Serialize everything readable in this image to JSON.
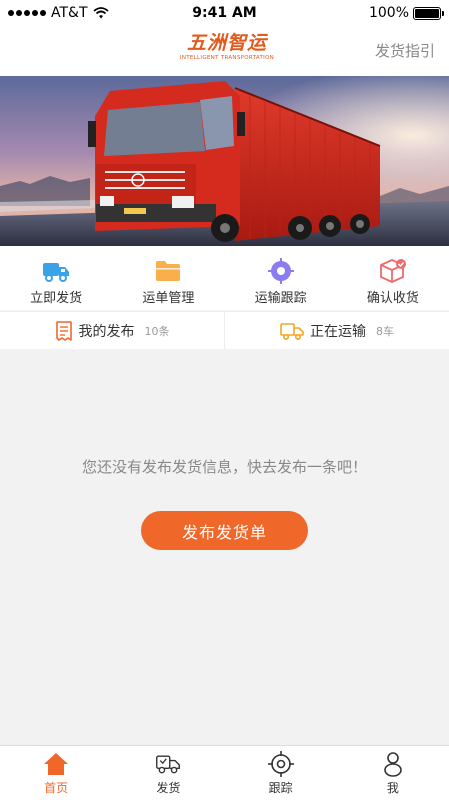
{
  "status_bar": {
    "carrier": "AT&T",
    "time": "9:41 AM",
    "battery": "100%"
  },
  "header": {
    "logo_text": "五洲智运",
    "logo_subtext": "INTELLIGENT TRANSPORTATION",
    "right_link": "发货指引"
  },
  "quick_actions": [
    {
      "label": "立即发货",
      "icon": "truck-icon"
    },
    {
      "label": "运单管理",
      "icon": "folder-icon"
    },
    {
      "label": "运输跟踪",
      "icon": "location-target-icon"
    },
    {
      "label": "确认收货",
      "icon": "package-check-icon"
    }
  ],
  "summary": {
    "published": {
      "label": "我的发布",
      "count": "10条"
    },
    "in_transit": {
      "label": "正在运输",
      "count": "8车"
    }
  },
  "empty_state": {
    "message": "您还没有发布发货信息，快去发布一条吧！",
    "button": "发布发货单"
  },
  "tabbar": [
    {
      "label": "首页",
      "icon": "home-icon",
      "active": true
    },
    {
      "label": "发货",
      "icon": "delivery-truck-icon",
      "active": false
    },
    {
      "label": "跟踪",
      "icon": "crosshair-icon",
      "active": false
    },
    {
      "label": "我",
      "icon": "user-icon",
      "active": false
    }
  ],
  "colors": {
    "accent": "#f0672a",
    "background": "#f2f2f2"
  }
}
